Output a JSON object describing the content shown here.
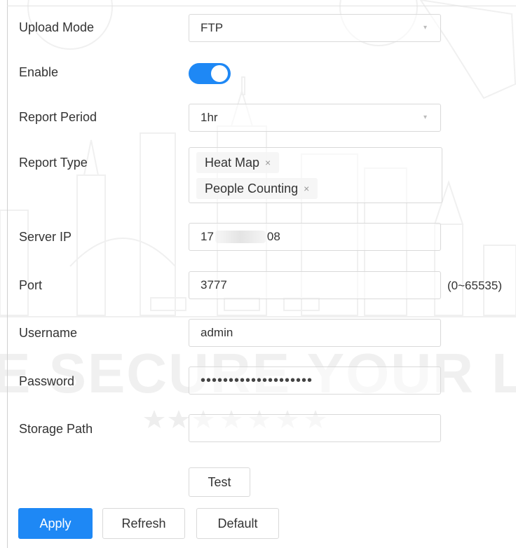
{
  "form": {
    "upload_mode": {
      "label": "Upload Mode",
      "value": "FTP"
    },
    "enable": {
      "label": "Enable",
      "on": true
    },
    "report_period": {
      "label": "Report Period",
      "value": "1hr"
    },
    "report_type": {
      "label": "Report Type",
      "tags": [
        "Heat Map",
        "People Counting"
      ],
      "remove_glyph": "×"
    },
    "server_ip": {
      "label": "Server IP",
      "value_prefix": "17",
      "value_suffix": "08"
    },
    "port": {
      "label": "Port",
      "value": "3777",
      "range_hint": "(0~65535)"
    },
    "username": {
      "label": "Username",
      "value": "admin"
    },
    "password": {
      "label": "Password",
      "value": "••••••••••••••••••••"
    },
    "storage_path": {
      "label": "Storage Path",
      "value": ""
    },
    "test_label": "Test"
  },
  "actions": {
    "apply": "Apply",
    "refresh": "Refresh",
    "default": "Default"
  },
  "watermark": {
    "text": "E SECURE YOUR LIF"
  },
  "colors": {
    "accent": "#1e88f5",
    "border": "#d9d9d9",
    "text": "#333333"
  }
}
